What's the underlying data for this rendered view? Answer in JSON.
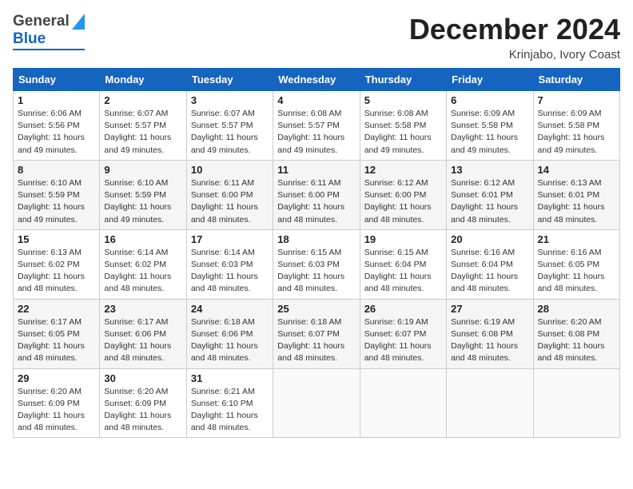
{
  "header": {
    "logo_general": "General",
    "logo_blue": "Blue",
    "month_title": "December 2024",
    "subtitle": "Krinjabo, Ivory Coast"
  },
  "days_of_week": [
    "Sunday",
    "Monday",
    "Tuesday",
    "Wednesday",
    "Thursday",
    "Friday",
    "Saturday"
  ],
  "weeks": [
    [
      {
        "day": "1",
        "info": "Sunrise: 6:06 AM\nSunset: 5:56 PM\nDaylight: 11 hours\nand 49 minutes."
      },
      {
        "day": "2",
        "info": "Sunrise: 6:07 AM\nSunset: 5:57 PM\nDaylight: 11 hours\nand 49 minutes."
      },
      {
        "day": "3",
        "info": "Sunrise: 6:07 AM\nSunset: 5:57 PM\nDaylight: 11 hours\nand 49 minutes."
      },
      {
        "day": "4",
        "info": "Sunrise: 6:08 AM\nSunset: 5:57 PM\nDaylight: 11 hours\nand 49 minutes."
      },
      {
        "day": "5",
        "info": "Sunrise: 6:08 AM\nSunset: 5:58 PM\nDaylight: 11 hours\nand 49 minutes."
      },
      {
        "day": "6",
        "info": "Sunrise: 6:09 AM\nSunset: 5:58 PM\nDaylight: 11 hours\nand 49 minutes."
      },
      {
        "day": "7",
        "info": "Sunrise: 6:09 AM\nSunset: 5:58 PM\nDaylight: 11 hours\nand 49 minutes."
      }
    ],
    [
      {
        "day": "8",
        "info": "Sunrise: 6:10 AM\nSunset: 5:59 PM\nDaylight: 11 hours\nand 49 minutes."
      },
      {
        "day": "9",
        "info": "Sunrise: 6:10 AM\nSunset: 5:59 PM\nDaylight: 11 hours\nand 49 minutes."
      },
      {
        "day": "10",
        "info": "Sunrise: 6:11 AM\nSunset: 6:00 PM\nDaylight: 11 hours\nand 48 minutes."
      },
      {
        "day": "11",
        "info": "Sunrise: 6:11 AM\nSunset: 6:00 PM\nDaylight: 11 hours\nand 48 minutes."
      },
      {
        "day": "12",
        "info": "Sunrise: 6:12 AM\nSunset: 6:00 PM\nDaylight: 11 hours\nand 48 minutes."
      },
      {
        "day": "13",
        "info": "Sunrise: 6:12 AM\nSunset: 6:01 PM\nDaylight: 11 hours\nand 48 minutes."
      },
      {
        "day": "14",
        "info": "Sunrise: 6:13 AM\nSunset: 6:01 PM\nDaylight: 11 hours\nand 48 minutes."
      }
    ],
    [
      {
        "day": "15",
        "info": "Sunrise: 6:13 AM\nSunset: 6:02 PM\nDaylight: 11 hours\nand 48 minutes."
      },
      {
        "day": "16",
        "info": "Sunrise: 6:14 AM\nSunset: 6:02 PM\nDaylight: 11 hours\nand 48 minutes."
      },
      {
        "day": "17",
        "info": "Sunrise: 6:14 AM\nSunset: 6:03 PM\nDaylight: 11 hours\nand 48 minutes."
      },
      {
        "day": "18",
        "info": "Sunrise: 6:15 AM\nSunset: 6:03 PM\nDaylight: 11 hours\nand 48 minutes."
      },
      {
        "day": "19",
        "info": "Sunrise: 6:15 AM\nSunset: 6:04 PM\nDaylight: 11 hours\nand 48 minutes."
      },
      {
        "day": "20",
        "info": "Sunrise: 6:16 AM\nSunset: 6:04 PM\nDaylight: 11 hours\nand 48 minutes."
      },
      {
        "day": "21",
        "info": "Sunrise: 6:16 AM\nSunset: 6:05 PM\nDaylight: 11 hours\nand 48 minutes."
      }
    ],
    [
      {
        "day": "22",
        "info": "Sunrise: 6:17 AM\nSunset: 6:05 PM\nDaylight: 11 hours\nand 48 minutes."
      },
      {
        "day": "23",
        "info": "Sunrise: 6:17 AM\nSunset: 6:06 PM\nDaylight: 11 hours\nand 48 minutes."
      },
      {
        "day": "24",
        "info": "Sunrise: 6:18 AM\nSunset: 6:06 PM\nDaylight: 11 hours\nand 48 minutes."
      },
      {
        "day": "25",
        "info": "Sunrise: 6:18 AM\nSunset: 6:07 PM\nDaylight: 11 hours\nand 48 minutes."
      },
      {
        "day": "26",
        "info": "Sunrise: 6:19 AM\nSunset: 6:07 PM\nDaylight: 11 hours\nand 48 minutes."
      },
      {
        "day": "27",
        "info": "Sunrise: 6:19 AM\nSunset: 6:08 PM\nDaylight: 11 hours\nand 48 minutes."
      },
      {
        "day": "28",
        "info": "Sunrise: 6:20 AM\nSunset: 6:08 PM\nDaylight: 11 hours\nand 48 minutes."
      }
    ],
    [
      {
        "day": "29",
        "info": "Sunrise: 6:20 AM\nSunset: 6:09 PM\nDaylight: 11 hours\nand 48 minutes."
      },
      {
        "day": "30",
        "info": "Sunrise: 6:20 AM\nSunset: 6:09 PM\nDaylight: 11 hours\nand 48 minutes."
      },
      {
        "day": "31",
        "info": "Sunrise: 6:21 AM\nSunset: 6:10 PM\nDaylight: 11 hours\nand 48 minutes."
      },
      {
        "day": "",
        "info": ""
      },
      {
        "day": "",
        "info": ""
      },
      {
        "day": "",
        "info": ""
      },
      {
        "day": "",
        "info": ""
      }
    ]
  ]
}
